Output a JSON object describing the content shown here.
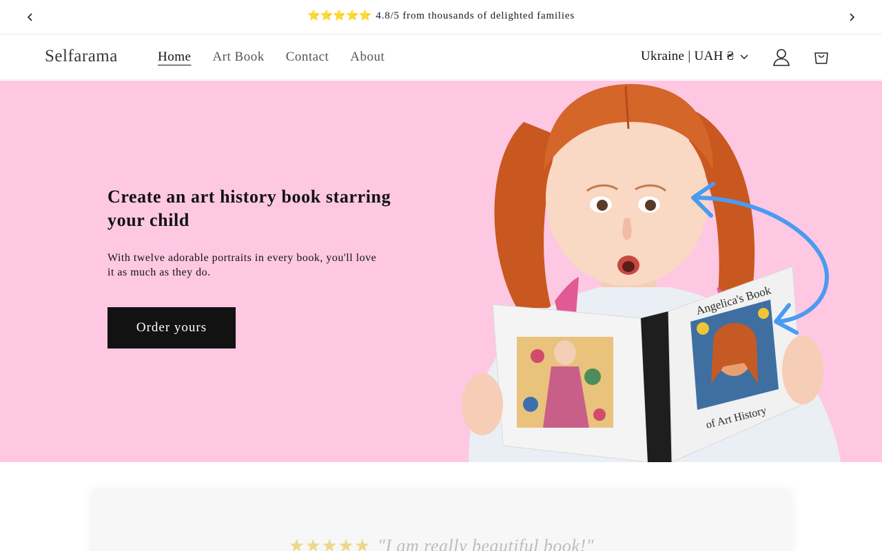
{
  "announcement": {
    "stars": "⭐⭐⭐⭐⭐",
    "text": "4.8/5 from thousands of delighted families"
  },
  "header": {
    "logo": "Selfarama",
    "nav": [
      {
        "label": "Home",
        "active": true
      },
      {
        "label": "Art Book",
        "active": false
      },
      {
        "label": "Contact",
        "active": false
      },
      {
        "label": "About",
        "active": false
      }
    ],
    "locale": "Ukraine | UAH ₴",
    "icons": [
      "account-icon",
      "cart-icon"
    ]
  },
  "hero": {
    "title": "Create an art history book starring your child",
    "subtitle": "With twelve adorable portraits in every book, you'll love it as much as they do.",
    "cta": "Order yours",
    "book_title_top": "Angelica's Book",
    "book_title_bottom": "of Art History",
    "background": "#fec8e3"
  },
  "testimonial": {
    "stars": "★★★★★",
    "quote": "\"I am really beautiful book!\""
  }
}
